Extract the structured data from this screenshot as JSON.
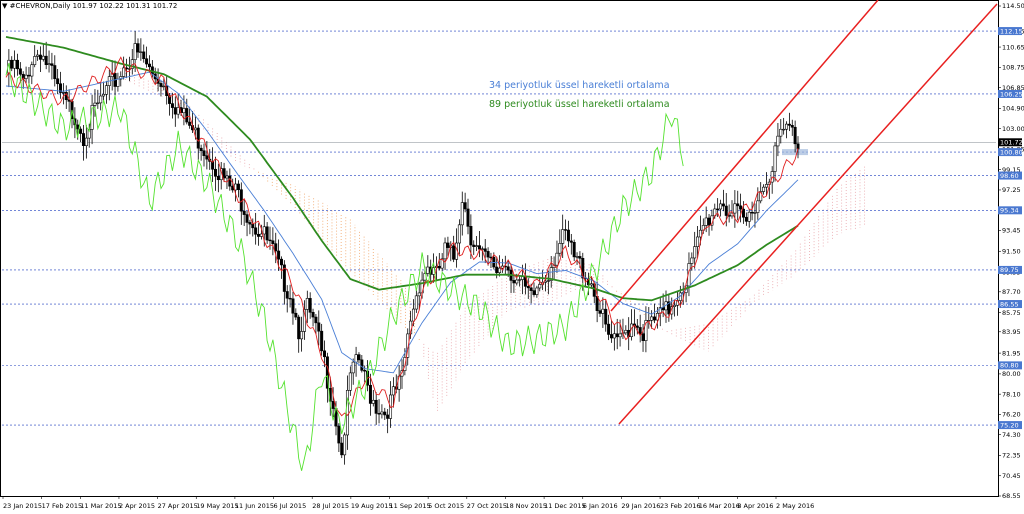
{
  "header": {
    "symbol": "#CHEVRON,Daily",
    "ohlc": "101.97 102.22 101.31 101.72"
  },
  "chart_data": {
    "type": "candlestick",
    "title": "#CHEVRON,Daily",
    "ylim": [
      68.55,
      114.5
    ],
    "y_ticks": [
      "114.50",
      "112.15",
      "110.65",
      "108.75",
      "106.85",
      "104.90",
      "103.00",
      "101.05",
      "99.15",
      "97.25",
      "95.34",
      "93.45",
      "91.50",
      "89.55",
      "87.70",
      "85.75",
      "83.95",
      "81.95",
      "80.00",
      "78.10",
      "76.20",
      "74.30",
      "72.35",
      "70.45",
      "68.55"
    ],
    "x_ticks": [
      "23 Jan 2015",
      "17 Feb 2015",
      "11 Mar 2015",
      "2 Apr 2015",
      "27 Apr 2015",
      "19 May 2015",
      "11 Jun 2015",
      "6 Jul 2015",
      "28 Jul 2015",
      "19 Aug 2015",
      "11 Sep 2015",
      "5 Oct 2015",
      "27 Oct 2015",
      "18 Nov 2015",
      "11 Dec 2015",
      "6 Jan 2016",
      "29 Jan 2016",
      "23 Feb 2016",
      "16 Mar 2016",
      "8 Apr 2016",
      "2 May 2016"
    ],
    "horizontal_levels": [
      {
        "label": "112.15",
        "value": 112.15
      },
      {
        "label": "106.25",
        "value": 106.25
      },
      {
        "label": "100.80",
        "value": 100.8
      },
      {
        "label": "98.60",
        "value": 98.6
      },
      {
        "label": "95.34",
        "value": 95.34
      },
      {
        "label": "89.75",
        "value": 89.75
      },
      {
        "label": "86.55",
        "value": 86.55
      },
      {
        "label": "80.80",
        "value": 80.8
      },
      {
        "label": "75.20",
        "value": 75.2
      }
    ],
    "current_price": {
      "label": "101.72",
      "value": 101.72
    },
    "legend": [
      {
        "name": "34 periyotluk üssel hareketli ortalama",
        "color": "#4a7fd6"
      },
      {
        "name": "89 periyotluk üssel hareketli ortalama",
        "color": "#2e8b1f"
      }
    ],
    "series": [
      {
        "name": "close",
        "color": "#000000",
        "points": [
          [
            0,
            108.2
          ],
          [
            3,
            108.8
          ],
          [
            6,
            107.0
          ],
          [
            9,
            109.5
          ],
          [
            12,
            110.4
          ],
          [
            15,
            108.6
          ],
          [
            18,
            106.5
          ],
          [
            21,
            105.1
          ],
          [
            24,
            104.3
          ],
          [
            27,
            102.5
          ],
          [
            30,
            104.1
          ],
          [
            33,
            105.6
          ],
          [
            36,
            106.8
          ],
          [
            39,
            107.9
          ],
          [
            42,
            109.2
          ],
          [
            45,
            110.1
          ],
          [
            48,
            109.4
          ],
          [
            51,
            108.0
          ],
          [
            54,
            107.6
          ],
          [
            57,
            106.2
          ],
          [
            60,
            104.8
          ],
          [
            63,
            103.6
          ],
          [
            66,
            102.4
          ],
          [
            69,
            101.2
          ],
          [
            72,
            100.1
          ],
          [
            75,
            98.6
          ],
          [
            78,
            97.4
          ],
          [
            81,
            96.8
          ],
          [
            84,
            95.2
          ],
          [
            87,
            93.8
          ],
          [
            90,
            92.9
          ],
          [
            93,
            91.4
          ],
          [
            96,
            89.2
          ],
          [
            99,
            87.6
          ],
          [
            102,
            84.3
          ],
          [
            105,
            86.1
          ],
          [
            108,
            84.0
          ],
          [
            111,
            80.9
          ],
          [
            114,
            77.3
          ],
          [
            117,
            72.5
          ],
          [
            120,
            79.8
          ],
          [
            123,
            81.2
          ],
          [
            126,
            78.6
          ],
          [
            129,
            77.1
          ],
          [
            132,
            76.4
          ],
          [
            135,
            77.9
          ],
          [
            138,
            79.4
          ],
          [
            141,
            85.2
          ],
          [
            144,
            88.6
          ],
          [
            147,
            90.1
          ],
          [
            150,
            89.1
          ],
          [
            153,
            91.5
          ],
          [
            156,
            90.8
          ],
          [
            159,
            96.8
          ],
          [
            162,
            93.1
          ],
          [
            165,
            91.2
          ],
          [
            168,
            90.4
          ],
          [
            171,
            89.8
          ],
          [
            174,
            90.6
          ],
          [
            177,
            89.2
          ],
          [
            180,
            88.1
          ],
          [
            183,
            86.9
          ],
          [
            186,
            88.5
          ],
          [
            189,
            89.7
          ],
          [
            192,
            91.8
          ],
          [
            195,
            92.8
          ],
          [
            198,
            90.8
          ],
          [
            201,
            89.9
          ],
          [
            204,
            88.6
          ],
          [
            207,
            85.8
          ],
          [
            210,
            83.4
          ],
          [
            213,
            82.6
          ],
          [
            216,
            84.1
          ],
          [
            219,
            85.2
          ],
          [
            222,
            83.9
          ],
          [
            225,
            84.8
          ],
          [
            228,
            85.3
          ],
          [
            231,
            86.1
          ],
          [
            234,
            87.6
          ],
          [
            237,
            88.9
          ],
          [
            240,
            91.2
          ],
          [
            243,
            93.8
          ],
          [
            246,
            95.1
          ],
          [
            249,
            96.4
          ],
          [
            252,
            95.2
          ],
          [
            255,
            94.7
          ],
          [
            258,
            94.1
          ],
          [
            261,
            96.2
          ],
          [
            264,
            97.6
          ],
          [
            267,
            99.8
          ],
          [
            270,
            102.5
          ],
          [
            273,
            103.0
          ],
          [
            276,
            101.7
          ]
        ]
      },
      {
        "name": "EMA 34",
        "color": "#4a7fd6",
        "points": [
          [
            0,
            107.0
          ],
          [
            20,
            106.5
          ],
          [
            40,
            107.7
          ],
          [
            50,
            108.3
          ],
          [
            60,
            106.3
          ],
          [
            70,
            102.8
          ],
          [
            80,
            99.0
          ],
          [
            90,
            95.3
          ],
          [
            100,
            91.3
          ],
          [
            110,
            87.0
          ],
          [
            117,
            82.0
          ],
          [
            125,
            80.5
          ],
          [
            135,
            80.1
          ],
          [
            145,
            84.8
          ],
          [
            155,
            88.6
          ],
          [
            165,
            90.5
          ],
          [
            175,
            90.4
          ],
          [
            185,
            89.4
          ],
          [
            195,
            89.7
          ],
          [
            205,
            88.7
          ],
          [
            215,
            86.6
          ],
          [
            225,
            85.6
          ],
          [
            235,
            87.3
          ],
          [
            245,
            90.3
          ],
          [
            255,
            92.2
          ],
          [
            265,
            95.3
          ],
          [
            276,
            98.2
          ]
        ]
      },
      {
        "name": "EMA 89",
        "color": "#2e8b1f",
        "points": [
          [
            0,
            111.6
          ],
          [
            20,
            110.6
          ],
          [
            40,
            109.1
          ],
          [
            55,
            108.1
          ],
          [
            70,
            106.0
          ],
          [
            85,
            102.0
          ],
          [
            100,
            96.5
          ],
          [
            110,
            92.5
          ],
          [
            120,
            88.9
          ],
          [
            130,
            87.9
          ],
          [
            145,
            88.5
          ],
          [
            160,
            89.3
          ],
          [
            175,
            89.3
          ],
          [
            190,
            88.9
          ],
          [
            205,
            88.0
          ],
          [
            215,
            87.1
          ],
          [
            225,
            86.9
          ],
          [
            240,
            88.3
          ],
          [
            255,
            90.2
          ],
          [
            265,
            92.1
          ],
          [
            276,
            93.9
          ]
        ]
      },
      {
        "name": "Tenkan",
        "color": "#e02020",
        "points": [
          [
            0,
            107.8
          ],
          [
            20,
            105.6
          ],
          [
            40,
            109.1
          ],
          [
            55,
            107.4
          ],
          [
            70,
            101.0
          ],
          [
            85,
            95.1
          ],
          [
            100,
            88.3
          ],
          [
            110,
            82.0
          ],
          [
            117,
            75.5
          ],
          [
            125,
            79.6
          ],
          [
            135,
            77.2
          ],
          [
            145,
            87.6
          ],
          [
            155,
            91.8
          ],
          [
            165,
            91.2
          ],
          [
            175,
            90.1
          ],
          [
            185,
            88.3
          ],
          [
            195,
            91.5
          ],
          [
            205,
            88.2
          ],
          [
            215,
            83.7
          ],
          [
            225,
            84.5
          ],
          [
            235,
            86.8
          ],
          [
            245,
            94.4
          ],
          [
            255,
            94.8
          ],
          [
            265,
            97.2
          ],
          [
            276,
            100.8
          ]
        ]
      },
      {
        "name": "Chikou",
        "color": "#55e22f",
        "points": [
          [
            0,
            108.0
          ],
          [
            20,
            103.1
          ],
          [
            40,
            104.9
          ],
          [
            50,
            96.2
          ],
          [
            60,
            101.4
          ],
          [
            70,
            98.0
          ],
          [
            80,
            93.0
          ],
          [
            90,
            85.1
          ],
          [
            100,
            74.8
          ],
          [
            104,
            71.0
          ],
          [
            110,
            80.2
          ],
          [
            116,
            75.1
          ],
          [
            125,
            78.9
          ],
          [
            135,
            85.5
          ],
          [
            145,
            90.0
          ],
          [
            155,
            87.9
          ],
          [
            165,
            86.2
          ],
          [
            175,
            82.7
          ],
          [
            185,
            83.3
          ],
          [
            195,
            84.5
          ],
          [
            205,
            89.5
          ],
          [
            215,
            95.5
          ],
          [
            225,
            98.9
          ],
          [
            232,
            104.6
          ],
          [
            236,
            100.6
          ]
        ]
      }
    ]
  }
}
